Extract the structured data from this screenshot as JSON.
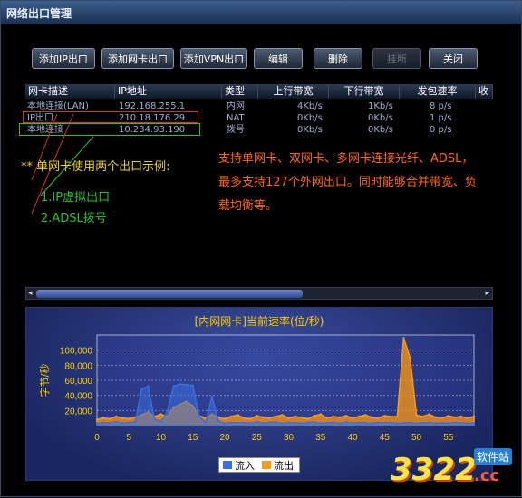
{
  "window": {
    "title": "网络出口管理"
  },
  "toolbar": {
    "add_ip": "添加IP出口",
    "add_nic": "添加网卡出口",
    "add_vpn": "添加VPN出口",
    "edit": "编辑",
    "delete": "删除",
    "hangup": "挂断",
    "close": "关闭"
  },
  "table": {
    "headers": [
      "网卡描述",
      "IP地址",
      "类型",
      "上行带宽",
      "下行带宽",
      "发包速率",
      "收"
    ],
    "rows": [
      {
        "desc": "本地连接(LAN)",
        "ip": "192.168.255.1",
        "type": "内网",
        "up": "4Kb/s",
        "down": "1Kb/s",
        "rate": "8 p/s"
      },
      {
        "desc": "IP出口",
        "ip": "210.18.176.29",
        "type": "NAT",
        "up": "0Kb/s",
        "down": "0Kb/s",
        "rate": "1 p/s"
      },
      {
        "desc": "本地连接",
        "ip": "10.234.93.190",
        "type": "拨号",
        "up": "0Kb/s",
        "down": "0Kb/s",
        "rate": "0 p/s"
      }
    ]
  },
  "annotations": {
    "example_title": "** 单网卡使用两个出口示例:",
    "item1": "1.IP虚拟出口",
    "item2": "2.ADSL拨号",
    "description": "支持单网卡、双网卡、多网卡连接光纤、ADSL，最多支持127个外网出口。同时能够合并带宽、负载均衡等。"
  },
  "colors": {
    "inflow": "#3b6fe0",
    "outflow": "#ff9a10",
    "accent_yellow": "#e8d030",
    "accent_green": "#30c030",
    "accent_orange": "#ff6a10",
    "highlight_red": "#d03030"
  },
  "watermark": {
    "main": "3322",
    "site": "软件站",
    "domain": ".cc"
  },
  "chart_data": {
    "type": "area",
    "title": "[内网网卡]当前速率(位/秒)",
    "ylabel": "字节/秒",
    "xlabel": "",
    "xlim": [
      0,
      59
    ],
    "ylim": [
      0,
      120000
    ],
    "x_ticks": [
      0,
      5,
      10,
      15,
      20,
      25,
      30,
      35,
      40,
      45,
      50,
      55
    ],
    "y_ticks": [
      "20,000",
      "40,000",
      "60,000",
      "80,000",
      "100,000"
    ],
    "y_tick_values": [
      20000,
      40000,
      60000,
      80000,
      100000
    ],
    "legend_position": "bottom-center",
    "series": [
      {
        "name": "流入",
        "values": [
          3000,
          4000,
          3500,
          5000,
          3000,
          4000,
          5000,
          48000,
          52000,
          9000,
          5000,
          18000,
          52000,
          55000,
          54000,
          53000,
          12000,
          4000,
          38000,
          6000,
          3000,
          4000,
          3500,
          4000,
          3000,
          5000,
          3000,
          4000,
          4500,
          3000,
          4000,
          3500,
          3000,
          4000,
          4500,
          3000,
          3500,
          4000,
          3000,
          4500,
          3000,
          4000,
          3500,
          3000,
          4000,
          3500,
          4000,
          3000,
          3500,
          4000,
          3000,
          3500,
          4000,
          3000,
          3500,
          3000,
          4000,
          3500,
          3000,
          3500
        ]
      },
      {
        "name": "流出",
        "values": [
          8000,
          10000,
          9000,
          12000,
          10000,
          9000,
          11000,
          14000,
          18000,
          12000,
          15000,
          12000,
          24000,
          28000,
          32000,
          26000,
          13000,
          10000,
          15000,
          11000,
          9000,
          12000,
          14000,
          10000,
          9000,
          13000,
          11000,
          10000,
          12000,
          14000,
          10000,
          12000,
          11000,
          9000,
          13000,
          15000,
          10000,
          12000,
          11000,
          13000,
          10000,
          12000,
          14000,
          11000,
          10000,
          13000,
          12000,
          12000,
          116000,
          90000,
          14000,
          12000,
          15000,
          11000,
          10000,
          13000,
          11000,
          12000,
          10000,
          12000
        ]
      }
    ]
  }
}
